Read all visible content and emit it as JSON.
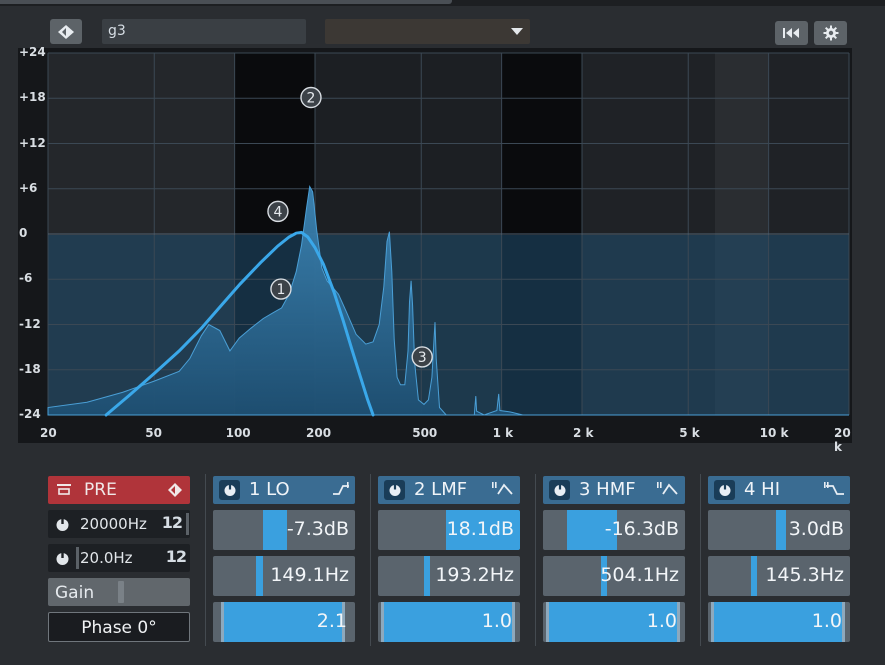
{
  "header": {
    "preset_name": "g3",
    "dropdown_value": ""
  },
  "display": {
    "y_ticks": [
      "+24",
      "+18",
      "+12",
      "+6",
      "0",
      "-6",
      "-12",
      "-18",
      "-24"
    ],
    "x_ticks": [
      "20",
      "50",
      "100",
      "200",
      "500",
      "1 k",
      "2 k",
      "5 k",
      "10 k",
      "20 k"
    ],
    "handles": [
      "1",
      "2",
      "3",
      "4"
    ],
    "colors": {
      "curve": "#3aa8ea",
      "spectrum": "#2f6b93",
      "grid": "#3b4854"
    }
  },
  "pre": {
    "label": "PRE",
    "highcut": {
      "value": "20000Hz",
      "slope": "12"
    },
    "lowcut": {
      "value": "20.0Hz",
      "slope": "12"
    },
    "gain_label": "Gain",
    "phase_label": "Phase 0°"
  },
  "bands": [
    {
      "label": "1 LO",
      "gain": "-7.3dB",
      "freq": "149.1Hz",
      "q": "2.1"
    },
    {
      "label": "2 LMF",
      "gain": "18.1dB",
      "freq": "193.2Hz",
      "q": "1.0"
    },
    {
      "label": "3 HMF",
      "gain": "-16.3dB",
      "freq": "504.1Hz",
      "q": "1.0"
    },
    {
      "label": "4 HI",
      "gain": "3.0dB",
      "freq": "145.3Hz",
      "q": "1.0"
    }
  ]
}
